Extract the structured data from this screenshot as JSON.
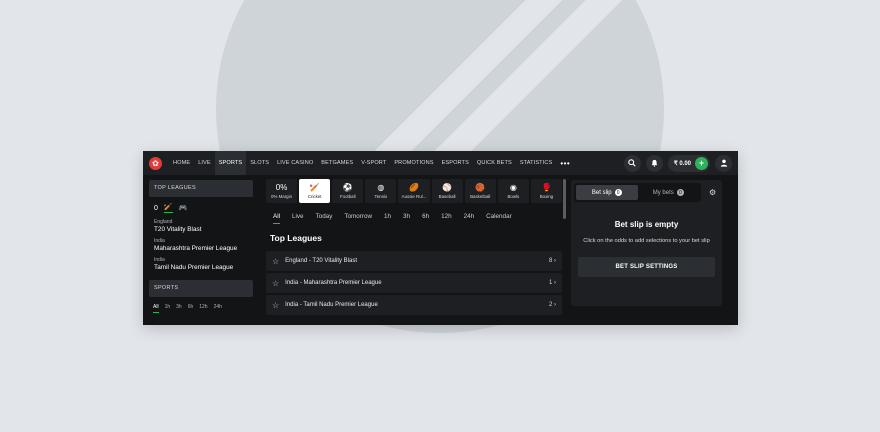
{
  "topnav": {
    "items": [
      "HOME",
      "LIVE",
      "SPORTS",
      "SLOTS",
      "LIVE CASINO",
      "BETGAMES",
      "V-SPORT",
      "PROMOTIONS",
      "ESPORTS",
      "QUICK BETS",
      "STATISTICS"
    ],
    "active": "SPORTS",
    "more": "•••",
    "balance": "₹ 0.00"
  },
  "left": {
    "top_leagues_heading": "TOP LEAGUES",
    "mini_tabs": [
      "0",
      "cricket-icon",
      "gamepad-icon"
    ],
    "leagues": [
      {
        "country": "England",
        "name": "T20 Vitality Blast"
      },
      {
        "country": "India",
        "name": "Maharashtra Premier League"
      },
      {
        "country": "India",
        "name": "Tamil Nadu Premier League"
      }
    ],
    "sports_heading": "SPORTS",
    "time_tabs": [
      "All",
      "1h",
      "3h",
      "6h",
      "12h",
      "24h"
    ]
  },
  "center": {
    "sports": [
      {
        "icon": "0%",
        "label": "0% Margin"
      },
      {
        "icon": "cricket-icon",
        "label": "Cricket"
      },
      {
        "icon": "football-icon",
        "label": "Football"
      },
      {
        "icon": "tennis-icon",
        "label": "Tennis"
      },
      {
        "icon": "aussie-rules-icon",
        "label": "Aussie Rul..."
      },
      {
        "icon": "baseball-icon",
        "label": "Baseball"
      },
      {
        "icon": "basketball-icon",
        "label": "Basketball"
      },
      {
        "icon": "bowls-icon",
        "label": "Bowls"
      },
      {
        "icon": "boxing-icon",
        "label": "Boxing"
      }
    ],
    "active_sport": "Cricket",
    "filters": [
      "All",
      "Live",
      "Today",
      "Tomorrow",
      "1h",
      "3h",
      "6h",
      "12h",
      "24h",
      "Calendar"
    ],
    "section_title": "Top Leagues",
    "rows": [
      {
        "name": "England - T20 Vitality Blast",
        "count": "8 ›"
      },
      {
        "name": "India - Maharashtra Premier League",
        "count": "1 ›"
      },
      {
        "name": "India - Tamil Nadu Premier League",
        "count": "2 ›"
      }
    ]
  },
  "betslip": {
    "tab_bet_slip": "Bet slip",
    "tab_bet_slip_count": "0",
    "tab_my_bets": "My bets",
    "tab_my_bets_count": "0",
    "empty_title": "Bet slip is empty",
    "empty_desc": "Click on the odds to add selections to your bet slip",
    "settings_button": "BET SLIP SETTINGS"
  },
  "colors": {
    "accent": "#2fb15b",
    "panel": "#1d1f22",
    "bg": "#131416",
    "logo": "#e33b3b"
  }
}
